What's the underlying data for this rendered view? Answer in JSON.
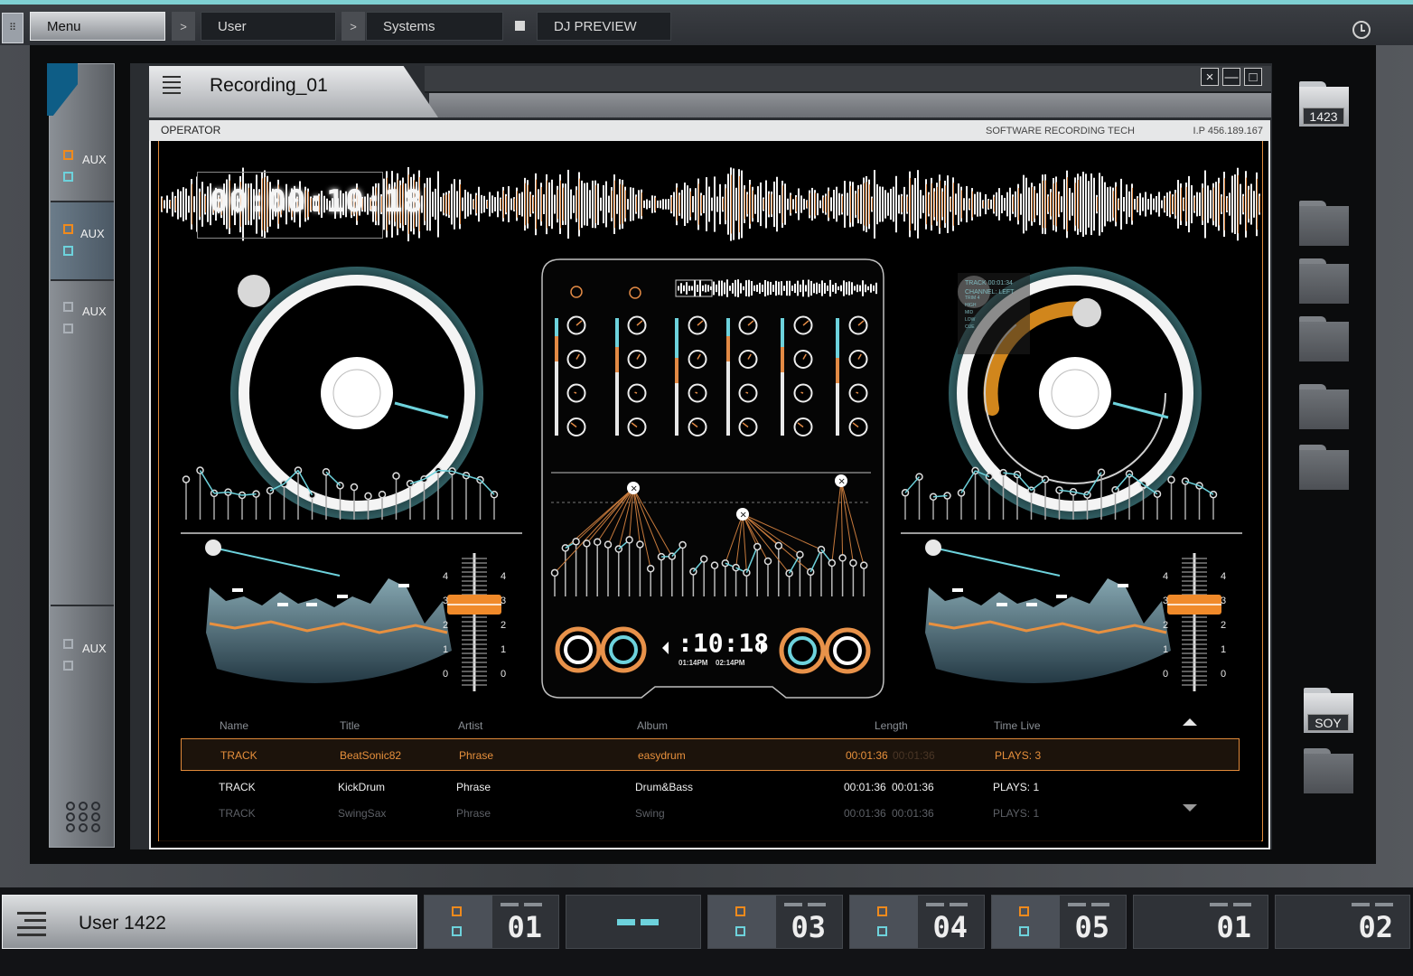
{
  "topbar": {
    "grid_icon": "grid-icon",
    "breadcrumbs": [
      "Menu",
      "User",
      "Systems",
      "DJ PREVIEW"
    ],
    "separators": [
      ">",
      ">"
    ],
    "clock_icon": "clock-icon"
  },
  "sidebar": {
    "items": [
      {
        "label": "AUX",
        "colors": [
          "orange",
          "cyan"
        ]
      },
      {
        "label": "AUX",
        "colors": [
          "orange",
          "cyan"
        ],
        "active": true
      },
      {
        "label": "AUX",
        "colors": [
          "gray",
          "gray"
        ]
      },
      {
        "label": "AUX",
        "colors": [
          "gray",
          "gray"
        ]
      }
    ]
  },
  "window": {
    "title": "Recording_01",
    "operator_label": "OPERATOR",
    "software_label": "SOFTWARE RECORDING TECH",
    "ip_label": "I.P 456.189.167",
    "controls": [
      "×",
      "—",
      "□"
    ]
  },
  "deck": {
    "timecode": "00:00:10:18",
    "center_time": ":10:18",
    "time_left": "01:14PM",
    "time_right": "02:14PM",
    "right_info": [
      "TRACK 00:01:34",
      "CHANNEL: LEFT",
      "TRIM 4",
      "HIGH",
      "MID",
      "LOW",
      "CUE"
    ],
    "fader_scale": [
      "4",
      "3",
      "2",
      "1",
      "0"
    ]
  },
  "tracks": {
    "headers": [
      "Name",
      "Title",
      "Artist",
      "Album",
      "Length",
      "Time Live"
    ],
    "rows": [
      {
        "name": "TRACK",
        "title": "BeatSonic82",
        "artist": "Phrase",
        "album": "easydrum",
        "length": "00:01:36",
        "length2": "00:01:36",
        "live": "PLAYS: 3"
      },
      {
        "name": "TRACK",
        "title": "KickDrum",
        "artist": "Phrase",
        "album": "Drum&Bass",
        "length": "00:01:36",
        "length2": "00:01:36",
        "live": "PLAYS: 1"
      },
      {
        "name": "TRACK",
        "title": "SwingSax",
        "artist": "Phrase",
        "album": "Swing",
        "length": "00:01:36",
        "length2": "00:01:36",
        "live": "PLAYS: 1"
      }
    ]
  },
  "folders": {
    "labels": [
      "1423",
      "SOY"
    ]
  },
  "taskbar": {
    "user": "User 1422",
    "tiles": [
      "01",
      "--",
      "03",
      "04",
      "05",
      "01",
      "02"
    ]
  },
  "colors": {
    "accent_cyan": "#6dd2dc",
    "accent_orange": "#f08a1c",
    "brand_blue": "#0e5d86"
  }
}
